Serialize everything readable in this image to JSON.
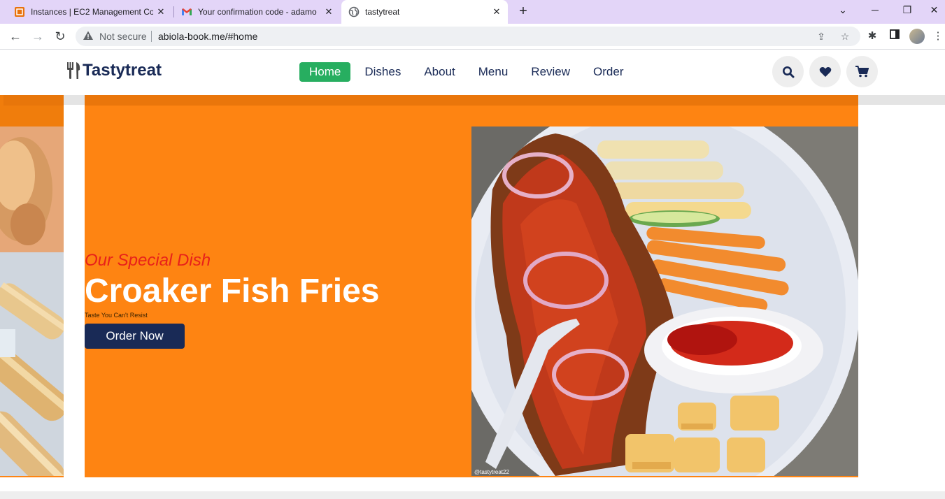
{
  "browser": {
    "tabs": [
      {
        "title": "Instances | EC2 Management Cor",
        "icon": "aws-icon",
        "active": false
      },
      {
        "title": "Your confirmation code - adamo",
        "icon": "gmail-icon",
        "active": false
      },
      {
        "title": "tastytreat",
        "icon": "globe-icon",
        "active": true
      }
    ],
    "security_label": "Not secure",
    "url": "abiola-book.me/#home"
  },
  "site": {
    "logo_text": "Tastytreat",
    "nav": [
      "Home",
      "Dishes",
      "About",
      "Menu",
      "Review",
      "Order"
    ],
    "active_nav": "Home",
    "header_icons": [
      "search-icon",
      "heart-icon",
      "cart-icon"
    ]
  },
  "hero": {
    "subtitle": "Our Special Dish",
    "title": "Croaker Fish Fries",
    "tagline": "Taste You Can't Resist",
    "button_label": "Order Now",
    "image_watermark": "@tastytreat22"
  },
  "colors": {
    "accent_green": "#27ae60",
    "brand_navy": "#192a56",
    "hero_orange": "#fe8412",
    "subtitle_red": "#e8211a"
  }
}
